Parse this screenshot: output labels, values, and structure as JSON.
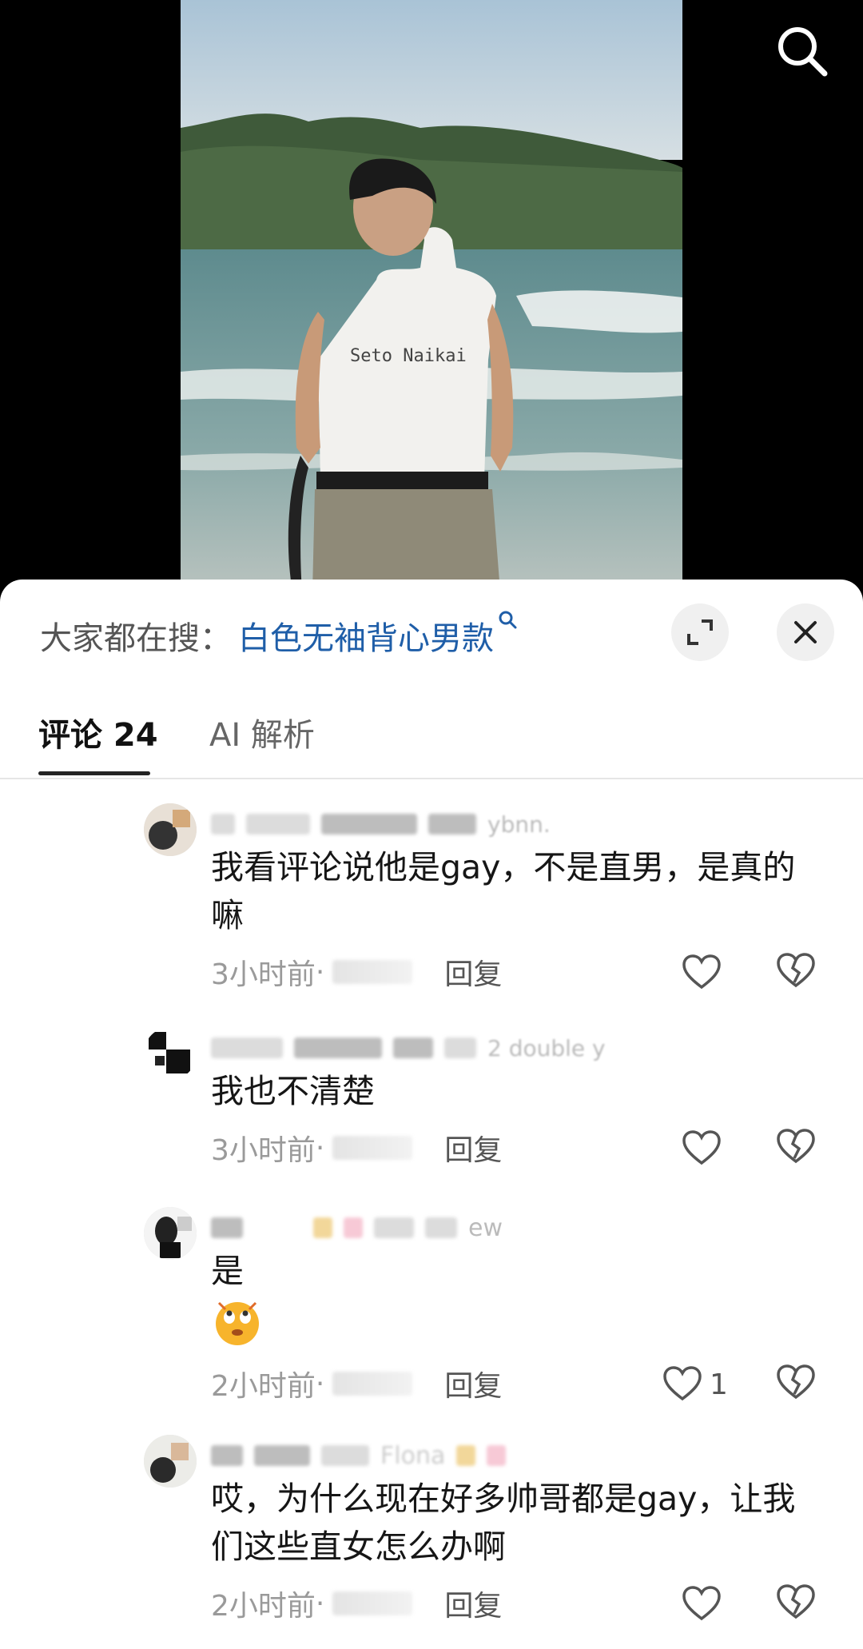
{
  "hot_search": {
    "lead": "大家都在搜：",
    "term": "白色无袖背心男款"
  },
  "video": {
    "shirt_text": "Seto Naikai"
  },
  "tabs": [
    {
      "label": "评论 24",
      "active": true
    },
    {
      "label": "AI 解析",
      "active": false
    }
  ],
  "comments": [
    {
      "username_fragment": "ybnn.",
      "text": "我看评论说他是gay，不是直男，是真的嘛",
      "time": "3小时前",
      "reply_label": "回复",
      "likes": ""
    },
    {
      "username_fragment": "2 double y",
      "text": "我也不清楚",
      "time": "3小时前",
      "reply_label": "回复",
      "likes": ""
    },
    {
      "username_fragment": "ew",
      "text": "是",
      "time": "2小时前",
      "reply_label": "回复",
      "likes": "1",
      "has_emoji": true
    },
    {
      "username_fragment": "Flona",
      "text": "哎，为什么现在好多帅哥都是gay，让我们这些直女怎么办啊",
      "time": "2小时前",
      "reply_label": "回复",
      "likes": ""
    }
  ],
  "icons": {
    "search": "search-icon",
    "expand": "expand-icon",
    "close": "close-icon",
    "like": "heart-icon",
    "dislike": "broken-heart-icon"
  },
  "colors": {
    "accent": "#1f5ea8",
    "background": "#ffffff",
    "muted": "#9a9a9a"
  },
  "separator": " · "
}
